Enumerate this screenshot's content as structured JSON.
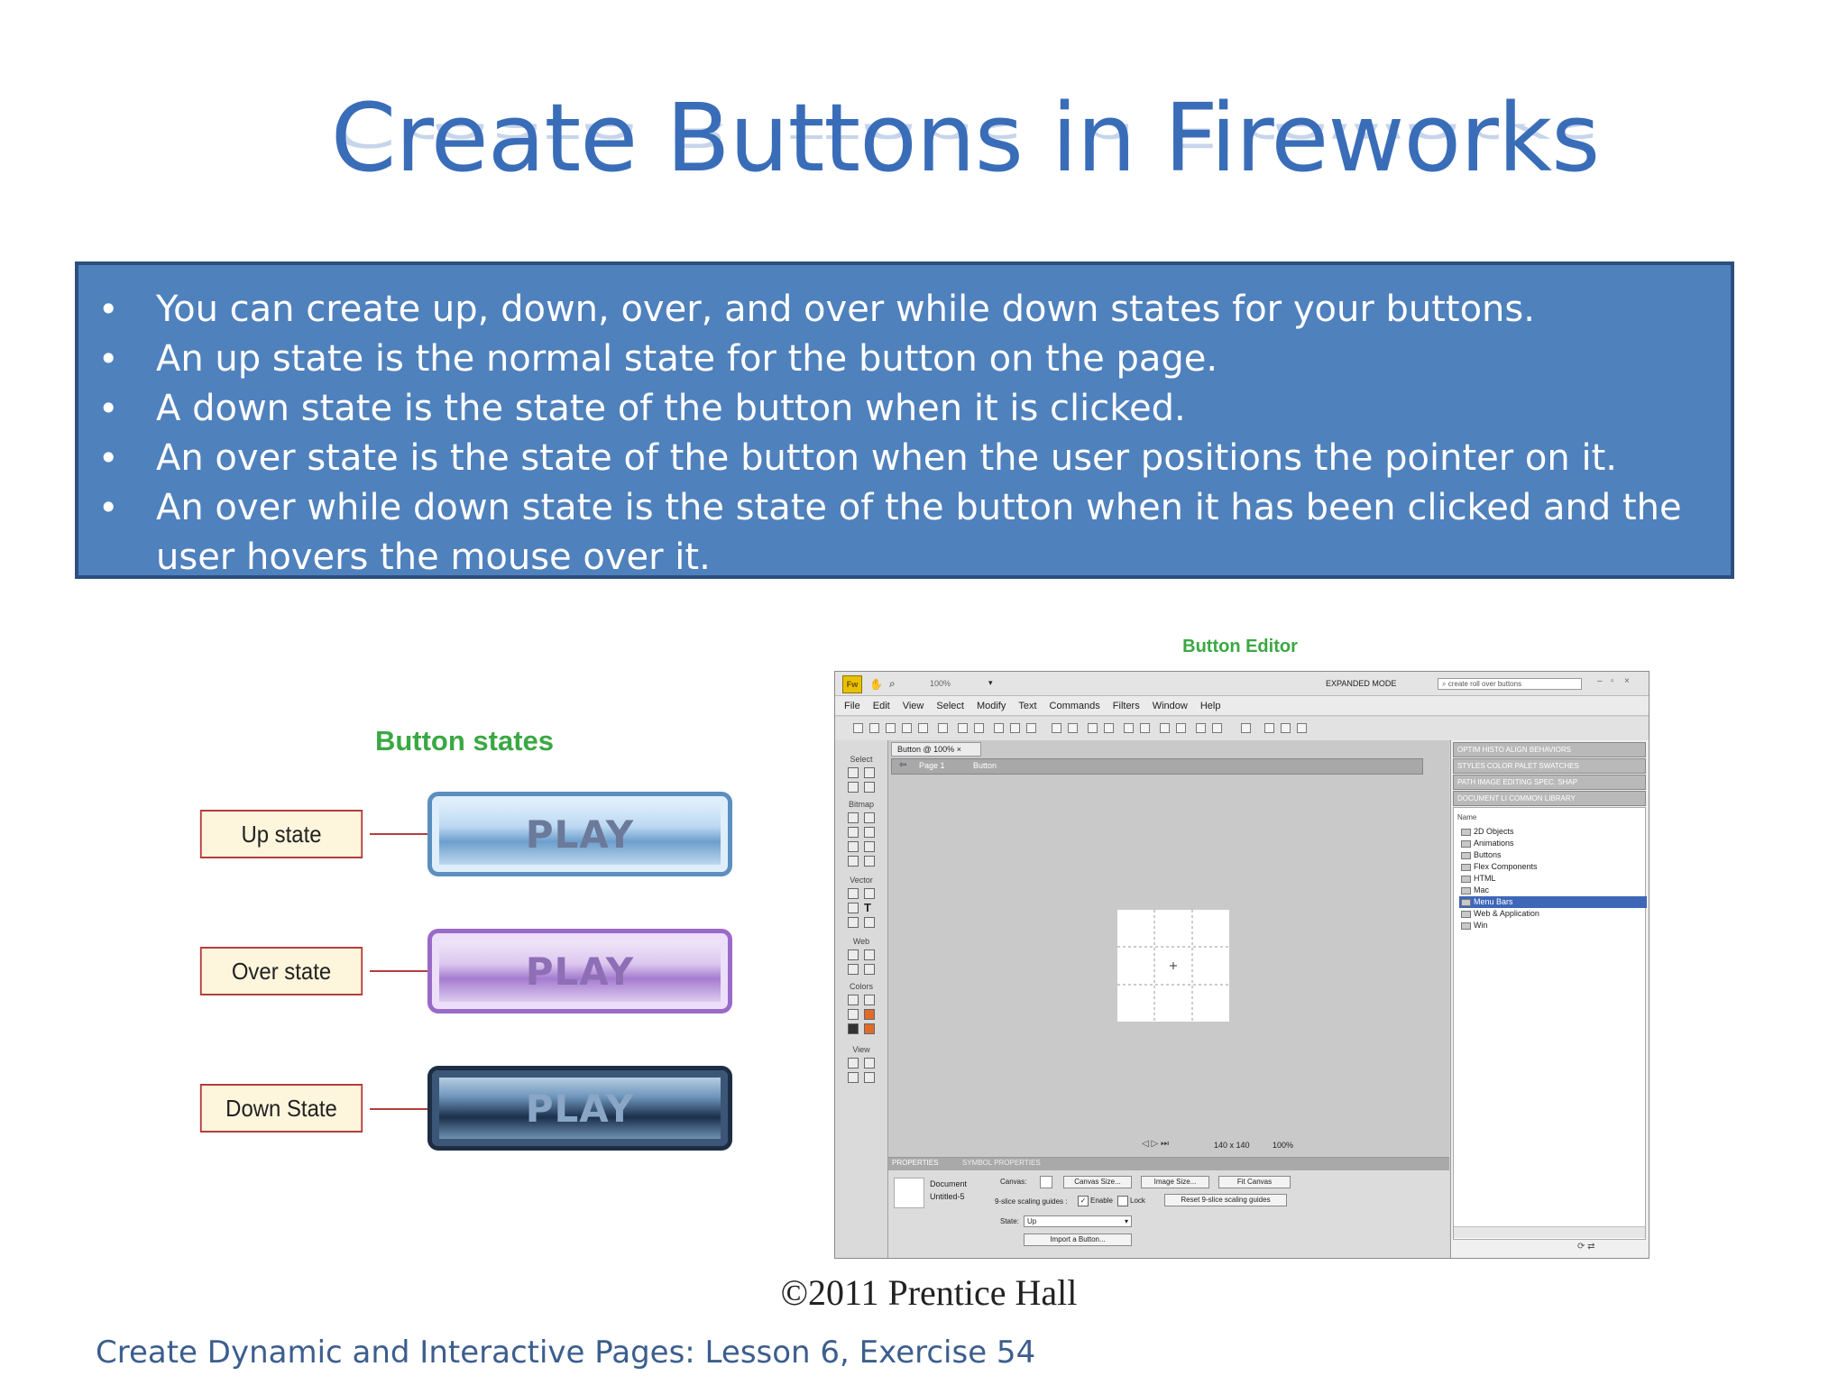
{
  "slide": {
    "title": "Create Buttons in Fireworks",
    "bullets": [
      "You can create up, down, over, and over while down states for your buttons.",
      "An up state is the normal state for the button on the page.",
      "A down state is the state of the button when it is clicked.",
      "An over state is the state of the button when the user positions the pointer on it.",
      "An over while down state is the state of the button when it has been clicked and the user hovers the mouse over it."
    ],
    "copyright": "©2011 Prentice Hall",
    "footer": "Create Dynamic and Interactive Pages: Lesson  6, Exercise 54"
  },
  "button_states": {
    "title": "Button states",
    "states": [
      {
        "label": "Up state",
        "button_text": "PLAY"
      },
      {
        "label": "Over state",
        "button_text": "PLAY"
      },
      {
        "label": "Down State",
        "button_text": "PLAY"
      }
    ]
  },
  "button_editor": {
    "title": "Button Editor",
    "app": {
      "logo": "Fw",
      "zoom": "100%",
      "mode": "EXPANDED MODE",
      "search_placeholder": "create roll over buttons",
      "menu": [
        "File",
        "Edit",
        "View",
        "Select",
        "Modify",
        "Text",
        "Commands",
        "Filters",
        "Window",
        "Help"
      ],
      "doc_tab": "Button @ 100%",
      "page_label": "Page 1",
      "button_label": "Button",
      "tool_sections": [
        "Select",
        "Bitmap",
        "Vector",
        "Web",
        "Colors",
        "View"
      ],
      "status": {
        "size": "140 x 140",
        "zoom": "100%"
      },
      "panel_tabs": [
        "OPTIM  HISTO  ALIGN  BEHAVIORS",
        "STYLES  COLOR PALET  SWATCHES",
        "PATH  IMAGE EDITING  SPEC. SHAP",
        "DOCUMENT LI  COMMON LIBRARY"
      ],
      "library_header": "Name",
      "library_items": [
        "2D Objects",
        "Animations",
        "Buttons",
        "Flex Components",
        "HTML",
        "Mac",
        "Menu Bars",
        "Web & Application",
        "Win"
      ],
      "library_selected": "Menu Bars",
      "properties": {
        "tabs": [
          "PROPERTIES",
          "SYMBOL PROPERTIES"
        ],
        "doc_label": "Document",
        "doc_name": "Untitled-5",
        "canvas_label": "Canvas:",
        "canvas_size_btn": "Canvas Size...",
        "image_size_btn": "Image Size...",
        "fit_canvas_btn": "Fit Canvas",
        "nine_slice_label": "9-slice scaling guides :",
        "enable_label": "Enable",
        "lock_label": "Lock",
        "reset_btn": "Reset 9-slice scaling guides",
        "state_label": "State:",
        "state_value": "Up",
        "import_btn": "Import a Button..."
      }
    }
  }
}
